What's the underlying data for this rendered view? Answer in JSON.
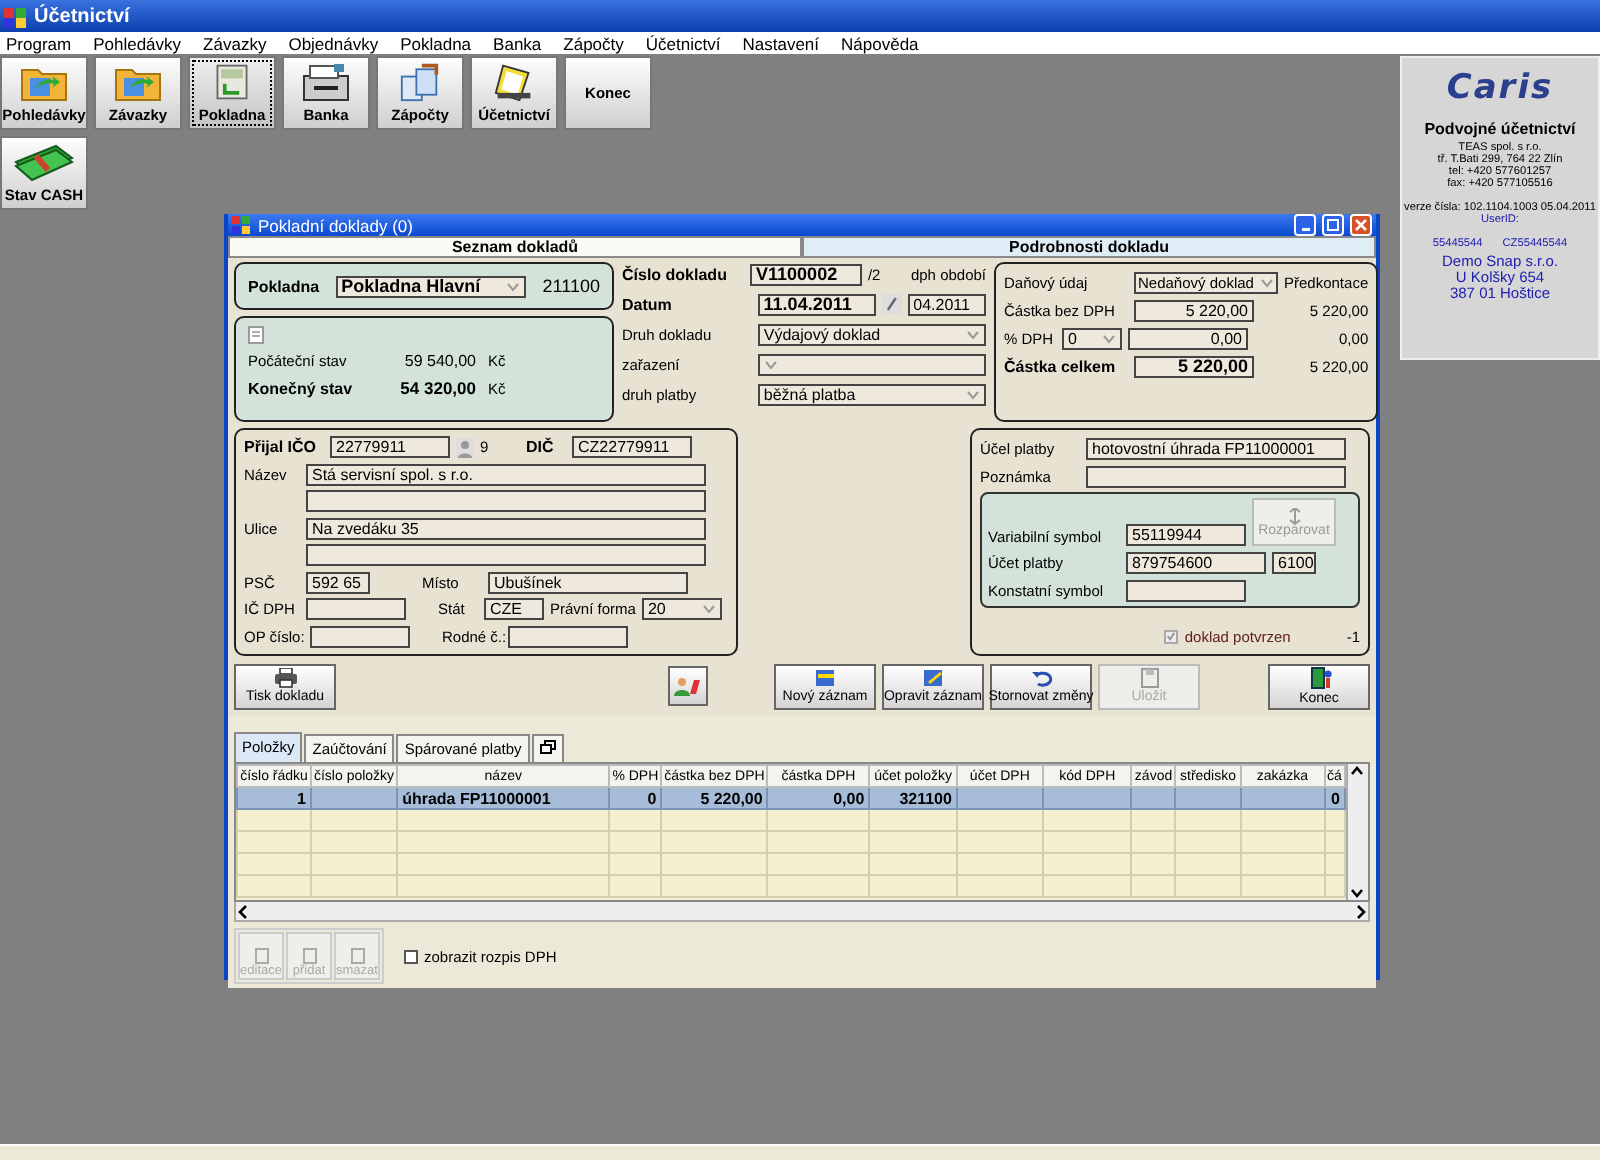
{
  "window": {
    "title": "Účetnictví"
  },
  "menu": [
    "Program",
    "Pohledávky",
    "Závazky",
    "Objednávky",
    "Pokladna",
    "Banka",
    "Zápočty",
    "Účetnictví",
    "Nastavení",
    "Nápověda"
  ],
  "toolbar": [
    {
      "label": "Pohledávky",
      "kind": "folder",
      "selected": false
    },
    {
      "label": "Závazky",
      "kind": "folder",
      "selected": false
    },
    {
      "label": "Pokladna",
      "kind": "register",
      "selected": true
    },
    {
      "label": "Banka",
      "kind": "drawer",
      "selected": false
    },
    {
      "label": "Zápočty",
      "kind": "documents",
      "selected": false
    },
    {
      "label": "Účetnictví",
      "kind": "clipboard",
      "selected": false
    },
    {
      "label": "Konec",
      "kind": "text",
      "selected": false
    }
  ],
  "toolbar_row2": [
    {
      "label": "Stav CASH",
      "kind": "money",
      "selected": false
    }
  ],
  "info_panel": {
    "logo": "Caris",
    "title": "Podvojné účetnictví",
    "company": "TEAS spol. s r.o.",
    "address": "tř. T.Bati 299, 764 22 Zlín",
    "tel": "tel: +420 577601257",
    "fax": "fax: +420 577105516",
    "version": "verze čísla: 102.1104.1003  05.04.2011",
    "user_id": "UserID:",
    "codes": [
      "55445544",
      "CZ55445544"
    ],
    "customer": [
      "Demo Snap s.r.o.",
      "U Kolšky 654",
      "387 01  Hoštice"
    ]
  },
  "dialog": {
    "title": "Pokladní doklady (0)",
    "tabs": [
      {
        "label": "Seznam dokladů",
        "selected": false
      },
      {
        "label": "Podrobnosti dokladu",
        "selected": true
      }
    ],
    "cash_box": {
      "label": "Pokladna",
      "value": "Pokladna Hlavní",
      "code": "211100"
    },
    "balances": [
      {
        "label": "Počáteční stav",
        "value": "59 540,00",
        "unit": "Kč",
        "kind": "opening"
      },
      {
        "label": "Konečný stav",
        "value": "54 320,00",
        "unit": "Kč",
        "kind": "closing"
      }
    ],
    "document": {
      "number_label": "Číslo dokladu",
      "number": "V1100002",
      "number_suffix": "/2",
      "period_label": "dph období",
      "period": "04.2011",
      "date_label": "Datum",
      "date": "11.04.2011",
      "type_label": "Druh dokladu",
      "type": "Výdajový doklad",
      "category_label": "zařazení",
      "payment_type_label": "druh platby",
      "payment_type": "běžná platba"
    },
    "tax": {
      "tax_label": "Daňový údaj",
      "tax_value": "Nedaňový doklad",
      "precontation_label": "Předkontace",
      "net_label": "Částka bez DPH",
      "net": "5 220,00",
      "net_pre": "5 220,00",
      "vat_label": "% DPH",
      "vat_rate": "0",
      "vat": "0,00",
      "vat_pre": "0,00",
      "total_label": "Částka celkem",
      "total": "5 220,00",
      "total_pre": "5 220,00"
    },
    "partner": {
      "ico_label": "Přijal IČO",
      "ico": "22779911",
      "ico_count": "9",
      "dic_label": "DIČ",
      "dic": "CZ22779911",
      "name_label": "Název",
      "name": "Stá servisní spol. s r.o.",
      "street_label": "Ulice",
      "street": "Na zvedáku 35",
      "zip_label": "PSČ",
      "zip": "592 65",
      "city_label": "Místo",
      "city": "Ubušínek",
      "vat_id_label": "IČ DPH",
      "country_label": "Stát",
      "country": "CZE",
      "legal_form_label": "Právní forma",
      "legal_form": "20",
      "id_card_label": "OP číslo:",
      "birth_no_label": "Rodné č.:"
    },
    "payment": {
      "purpose_label": "Účel platby",
      "purpose": "hotovostní úhrada FP11000001",
      "note_label": "Poznámka",
      "vs_label": "Variabilní symbol",
      "vs": "55119944",
      "account_label": "Účet platby",
      "account": "879754600",
      "bank_code": "6100",
      "ks_label": "Konstatní symbol",
      "unpair": {
        "label": "Rozpárovat",
        "disabled": true
      },
      "confirmed": {
        "label": "doklad potvrzen",
        "checked": true,
        "disabled": true
      },
      "flag": "-1"
    },
    "buttons": [
      {
        "label": "Tisk dokladu",
        "kind": "printer",
        "disabled": false
      },
      {
        "label": "Nový záznam",
        "kind": "new",
        "disabled": false
      },
      {
        "label": "Opravit záznam",
        "kind": "edit",
        "disabled": false
      },
      {
        "label": "Stornovat změny",
        "kind": "undo",
        "disabled": false
      },
      {
        "label": "Uložit",
        "kind": "save",
        "disabled": true
      },
      {
        "label": "Konec",
        "kind": "exit",
        "disabled": false
      }
    ],
    "item_tabs": [
      {
        "label": "Položky",
        "selected": true
      },
      {
        "label": "Zaúčtování",
        "selected": false
      },
      {
        "label": "Spárované platby",
        "selected": false
      }
    ],
    "table": {
      "columns": [
        "číslo řádku",
        "číslo položky",
        "název",
        "% DPH",
        "částka bez DPH",
        "částka DPH",
        "účet položky",
        "účet DPH",
        "kód DPH",
        "závod",
        "středisko",
        "zakázka",
        "čá"
      ],
      "rows": [
        {
          "selected": true,
          "cells": [
            "1",
            "",
            "úhrada FP11000001",
            "0",
            "5 220,00",
            "0,00",
            "321100",
            "",
            "",
            "",
            "",
            "",
            "0"
          ]
        }
      ]
    },
    "item_buttons": [
      {
        "label": "editace",
        "disabled": true
      },
      {
        "label": "přidat",
        "disabled": true
      },
      {
        "label": "smazat",
        "disabled": true
      }
    ],
    "vat_breakdown": {
      "label": "zobrazit rozpis DPH",
      "checked": false
    }
  }
}
